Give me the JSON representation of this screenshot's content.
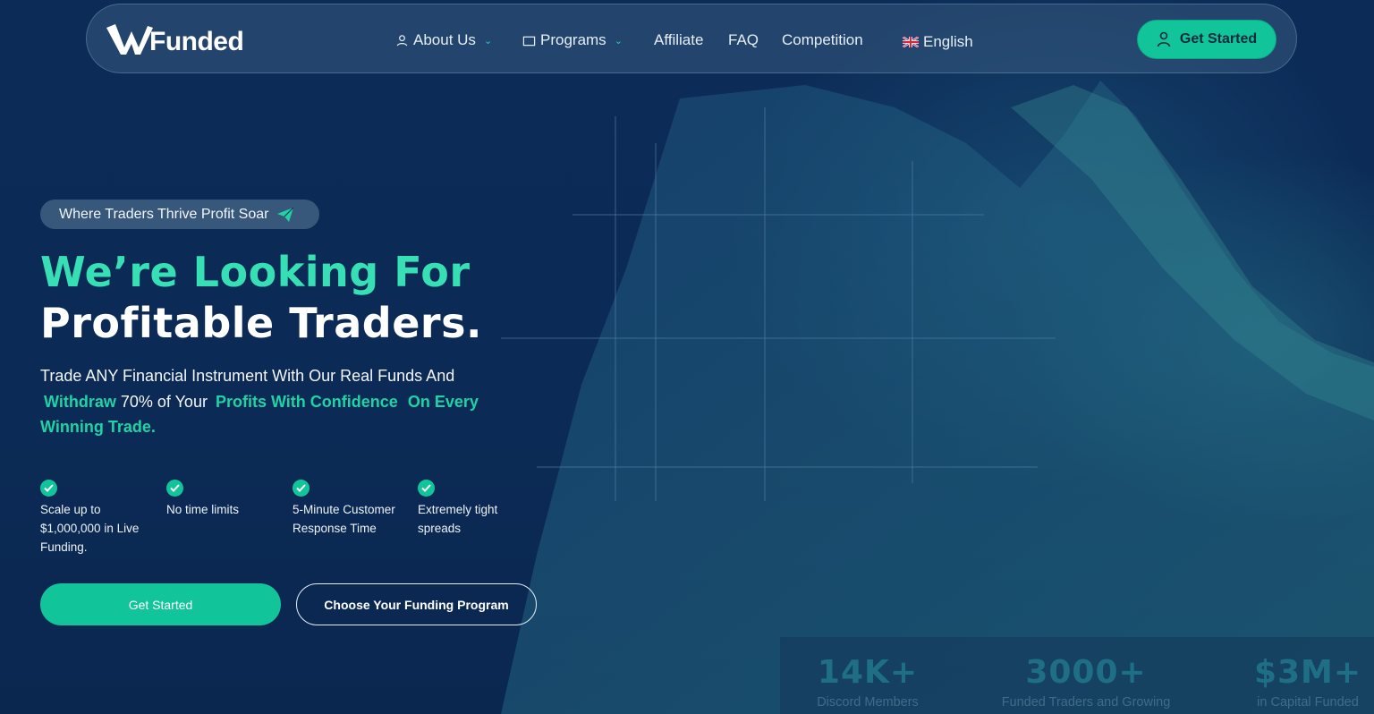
{
  "brand": {
    "name": "Funded",
    "mark_letter": "W"
  },
  "nav": {
    "items": [
      {
        "label": "About Us",
        "icon": "user-icon",
        "dropdown": true
      },
      {
        "label": "Programs",
        "icon": "folder-icon",
        "dropdown": true
      },
      {
        "label": "Affiliate"
      },
      {
        "label": "FAQ"
      },
      {
        "label": "Competition"
      }
    ],
    "language": {
      "label": "English",
      "flag": "uk-flag-icon"
    },
    "cta_label": "Get Started"
  },
  "hero": {
    "tagline": "Where Traders Thrive Profit Soar",
    "headline_line1": "We’re Looking For",
    "headline_line2": "Profitable Traders.",
    "sub_part1": "Trade ANY Financial Instrument With Our Real Funds And",
    "sub_hl1": "Withdraw",
    "sub_part2": "70% of Your",
    "sub_hl2": "Profits With Confidence",
    "sub_hl3": "On Every Winning Trade.",
    "features": [
      {
        "line1": "Scale up to",
        "line2": "$1,000,000 in Live",
        "line3": "Funding."
      },
      {
        "line1": "No time limits",
        "line2": "",
        "line3": ""
      },
      {
        "line1": "5-Minute Customer",
        "line2": "Response Time",
        "line3": ""
      },
      {
        "line1": "Extremely tight",
        "line2": "spreads",
        "line3": ""
      }
    ],
    "primary_button": "Get Started",
    "secondary_button": "Choose Your Funding Program"
  },
  "stats": [
    {
      "value": "14K+",
      "label": "Discord  Members"
    },
    {
      "value": "3000+",
      "label": "Funded Traders and Growing"
    },
    {
      "value": "$3M+",
      "label": "in Capital Funded"
    }
  ],
  "colors": {
    "accent": "#12c49a",
    "headline_accent": "#37e0b4",
    "background": "#0b2a55"
  }
}
